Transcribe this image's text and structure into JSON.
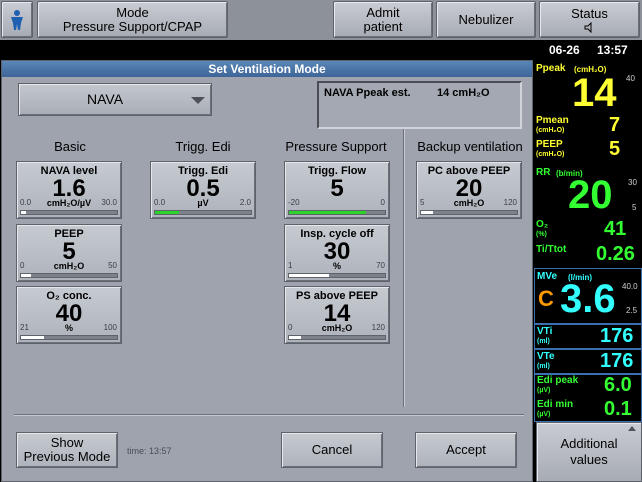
{
  "topbar": {
    "mode_label": "Mode",
    "mode_value": "Pressure Support/CPAP",
    "admit_line1": "Admit",
    "admit_line2": "patient",
    "nebulizer": "Nebulizer",
    "status": "Status",
    "status_icon": "speaker-muted-icon"
  },
  "datetime": {
    "date": "06-26",
    "time": "13:57"
  },
  "dialog": {
    "title": "Set Ventilation Mode",
    "mode_select": "NAVA",
    "estimate_label": "NAVA Ppeak est.",
    "estimate_value": "14 cmH₂O",
    "columns": {
      "basic": "Basic",
      "trigg": "Trigg. Edi",
      "ps": "Pressure Support",
      "backup": "Backup ventilation"
    },
    "params": {
      "nava_level": {
        "label": "NAVA level",
        "value": "1.6",
        "unit": "cmH₂O/µV",
        "min": "0.0",
        "max": "30.0",
        "fraction": 0.053
      },
      "peep": {
        "label": "PEEP",
        "value": "5",
        "unit": "cmH₂O",
        "min": "0",
        "max": "50",
        "fraction": 0.1
      },
      "o2": {
        "label": "O₂ conc.",
        "value": "40",
        "unit": "%",
        "min": "21",
        "max": "100",
        "fraction": 0.24
      },
      "trigg_edi": {
        "label": "Trigg. Edi",
        "value": "0.5",
        "unit": "µV",
        "min": "0.0",
        "max": "2.0",
        "fraction": 0.25
      },
      "trigg_flow": {
        "label": "Trigg. Flow",
        "value": "5",
        "unit": "",
        "min": "-20",
        "max": "0",
        "fraction": 0.8
      },
      "insp_cycle": {
        "label": "Insp. cycle off",
        "value": "30",
        "unit": "%",
        "min": "1",
        "max": "70",
        "fraction": 0.42
      },
      "ps_above": {
        "label": "PS above PEEP",
        "value": "14",
        "unit": "cmH₂O",
        "min": "0",
        "max": "120",
        "fraction": 0.12
      },
      "pc_above": {
        "label": "PC above PEEP",
        "value": "20",
        "unit": "cmH₂O",
        "min": "5",
        "max": "120",
        "fraction": 0.13
      }
    },
    "buttons": {
      "show_prev_line1": "Show",
      "show_prev_line2": "Previous Mode",
      "time_label": "time: 13:57",
      "cancel": "Cancel",
      "accept": "Accept"
    }
  },
  "sidebar": {
    "ppeak_label": "Ppeak",
    "ppeak_unit": "(cmH₂O)",
    "ppeak_value": "14",
    "ppeak_tick": "40",
    "pmean_label": "Pmean",
    "pmean_unit": "(cmH₂O)",
    "pmean_value": "7",
    "peep_label": "PEEP",
    "peep_unit": "(cmH₂O)",
    "peep_value": "5",
    "rr_label": "RR",
    "rr_unit": "(b/min)",
    "rr_value": "20",
    "rr_tick_hi": "30",
    "rr_tick_lo": "5",
    "o2_label": "O₂",
    "o2_unit": "(%)",
    "o2_value": "41",
    "titot_label": "Ti/Ttot",
    "titot_value": "0.26",
    "mve_label": "MVe",
    "mve_unit": "(l/min)",
    "mve_value": "3.6",
    "mve_prefix": "C",
    "mve_tick_hi": "40.0",
    "mve_tick_lo": "2.5",
    "vti_label": "VTi",
    "vti_unit": "(ml)",
    "vti_value": "176",
    "vte_label": "VTe",
    "vte_unit": "(ml)",
    "vte_value": "176",
    "edipeak_label": "Edi peak",
    "edipeak_unit": "(µV)",
    "edipeak_value": "6.0",
    "edimin_label": "Edi min",
    "edimin_unit": "(µV)",
    "edimin_value": "0.1",
    "additional_line1": "Additional",
    "additional_line2": "values"
  },
  "colors": {
    "yellow": "#ffff33",
    "green": "#33ff33",
    "cyan": "#33ffff",
    "orange": "#ff9900"
  }
}
